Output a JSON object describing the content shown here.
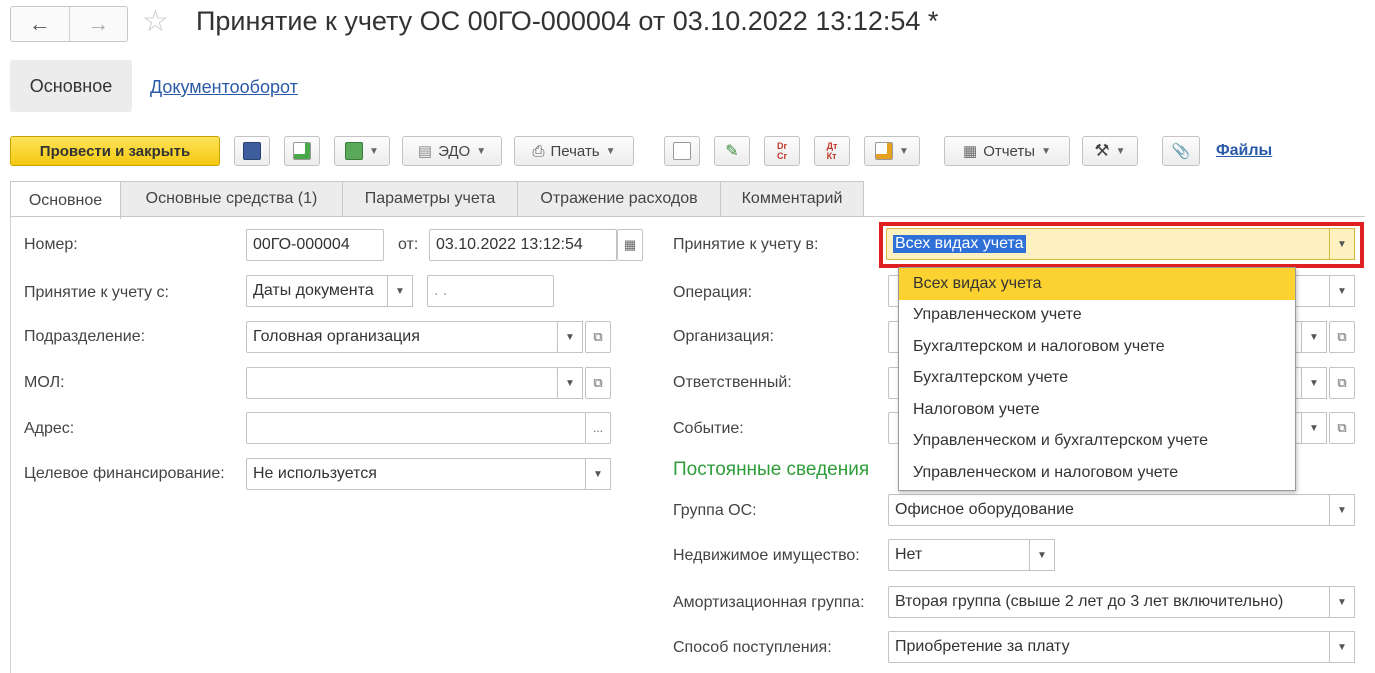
{
  "header": {
    "back_icon": "arrow-left-icon",
    "forward_icon": "arrow-right-icon",
    "title": "Принятие к учету ОС 00ГО-000004 от 03.10.2022 13:12:54 *"
  },
  "sections": {
    "active": "Основное",
    "link": "Документооборот"
  },
  "toolbar": {
    "post_close": "Провести и закрыть",
    "edo": "ЭДО",
    "print": "Печать",
    "reports": "Отчеты",
    "files": "Файлы"
  },
  "tabs": [
    "Основное",
    "Основные средства (1)",
    "Параметры учета",
    "Отражение расходов",
    "Комментарий"
  ],
  "left": {
    "number_label": "Номер:",
    "number_value": "00ГО-000004",
    "date_label": "от:",
    "date_value": "03.10.2022 13:12:54",
    "accept_from_label": "Принятие к учету с:",
    "accept_from_value": "Даты документа",
    "accept_from_date": ". .",
    "division_label": "Подразделение:",
    "division_value": "Головная организация",
    "mol_label": "МОЛ:",
    "mol_value": "",
    "address_label": "Адрес:",
    "address_value": "",
    "address_button": "...",
    "financing_label": "Целевое финансирование:",
    "financing_value": "Не используется"
  },
  "right": {
    "accept_in_label": "Принятие к учету в:",
    "accept_in_value": "Всех видах учета",
    "operation_label": "Операция:",
    "organization_label": "Организация:",
    "responsible_label": "Ответственный:",
    "event_label": "Событие:",
    "section_title": "Постоянные сведения",
    "os_group_label": "Группа ОС:",
    "os_group_value": "Офисное оборудование",
    "realty_label": "Недвижимое имущество:",
    "realty_value": "Нет",
    "amort_label": "Амортизационная группа:",
    "amort_value": "Вторая группа (свыше 2 лет до 3 лет включительно)",
    "receipt_label": "Способ поступления:",
    "receipt_value": "Приобретение за плату"
  },
  "dropdown": {
    "items": [
      "Всех видах учета",
      "Управленческом учете",
      "Бухгалтерском и налоговом учете",
      "Бухгалтерском учете",
      "Налоговом учете",
      "Управленческом и бухгалтерском учете",
      "Управленческом и налоговом учете"
    ],
    "highlighted_index": 0
  },
  "colors": {
    "primary": "#f5c90f",
    "link": "#2b5aa8",
    "section_title": "#2f9d3a",
    "highlight_frame": "#e02020",
    "selection": "#2e6fd8"
  }
}
